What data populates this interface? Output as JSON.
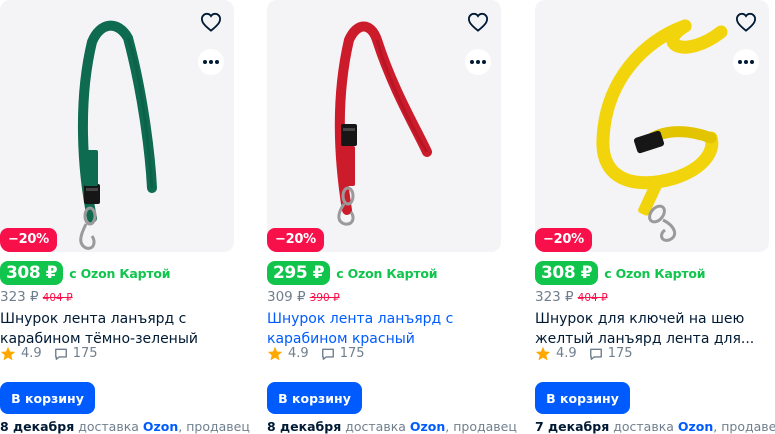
{
  "products": [
    {
      "discount": "−20%",
      "price": "308 ₽",
      "ozon_card_label": "c Ozon Картой",
      "current_price": "323 ₽",
      "old_price": "404 ₽",
      "title": "Шнурок лента ланъярд с карабином тёмно-зеленый",
      "rating": "4.9",
      "reviews": "175",
      "cart_label": "В корзину",
      "delivery_date": "8 декабря",
      "delivery_text": "доставка",
      "seller_name": "Ozon",
      "seller_suffix": ", продавец",
      "lanyard_color": "#0e6b4f"
    },
    {
      "discount": "−20%",
      "price": "295 ₽",
      "ozon_card_label": "c Ozon Картой",
      "current_price": "309 ₽",
      "old_price": "390 ₽",
      "title": "Шнурок лента ланъярд с карабином красный",
      "rating": "4.9",
      "reviews": "175",
      "cart_label": "В корзину",
      "delivery_date": "8 декабря",
      "delivery_text": "доставка",
      "seller_name": "Ozon",
      "seller_suffix": ", продавец",
      "lanyard_color": "#cc1b2b"
    },
    {
      "discount": "−20%",
      "price": "308 ₽",
      "ozon_card_label": "c Ozon Картой",
      "current_price": "323 ₽",
      "old_price": "404 ₽",
      "title": "Шнурок для ключей на шею желтый ланъярд лента для...",
      "rating": "4.9",
      "reviews": "175",
      "cart_label": "В корзину",
      "delivery_date": "7 декабря",
      "delivery_text": "доставка",
      "seller_name": "Ozon",
      "seller_suffix": ", продавец",
      "lanyard_color": "#f2d40c"
    }
  ],
  "icons": {
    "favorite": "heart-outline-icon",
    "more": "three-dots-icon",
    "rating": "star-icon",
    "reviews": "chat-bubble-icon"
  },
  "colors": {
    "green_price": "#10c44c",
    "discount_red": "#f8104b",
    "button_blue": "#005bff",
    "star": "#ffa800"
  }
}
